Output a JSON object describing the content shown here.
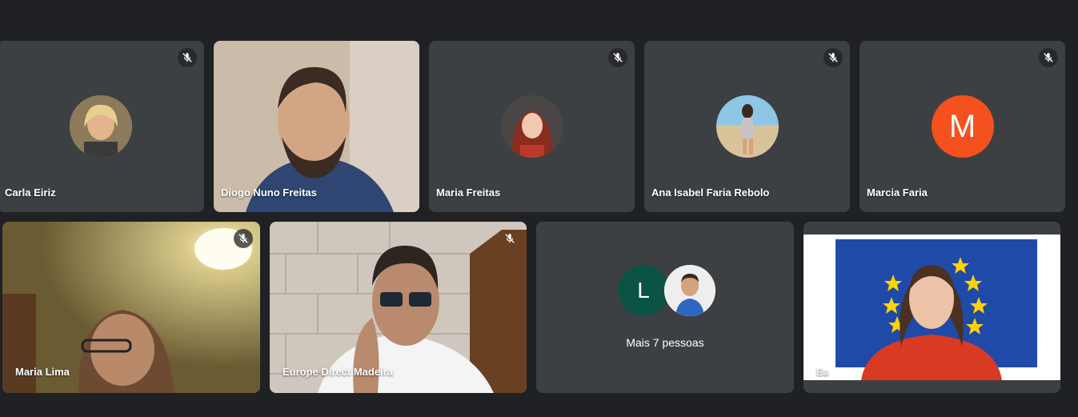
{
  "participants": [
    {
      "name": "Carla Eiriz",
      "muted": true,
      "display": "avatar-photo"
    },
    {
      "name": "Diogo Nuno Freitas",
      "muted": false,
      "display": "video"
    },
    {
      "name": "Maria Freitas",
      "muted": true,
      "display": "avatar-photo"
    },
    {
      "name": "Ana Isabel Faria Rebolo",
      "muted": true,
      "display": "avatar-photo"
    },
    {
      "name": "Marcia Faria",
      "muted": true,
      "display": "avatar-letter",
      "initial": "M",
      "avatar_color": "#f4511e"
    },
    {
      "name": "Maria Lima",
      "muted": true,
      "display": "video"
    },
    {
      "name": "Europe Direct Madeira",
      "muted": true,
      "display": "video"
    },
    {
      "name": "Eu",
      "muted": false,
      "display": "video"
    }
  ],
  "overflow": {
    "label": "Mais 7 pessoas",
    "initial": "L",
    "initial_color": "#0b5345"
  },
  "colors": {
    "background": "#202124",
    "tile": "#3c4043"
  },
  "icons": {
    "muted": "mic-off-icon"
  }
}
